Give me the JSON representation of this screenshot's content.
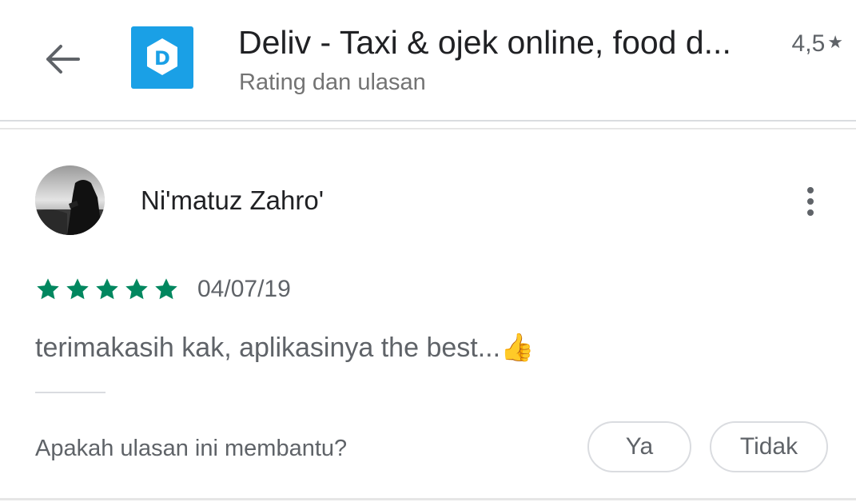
{
  "header": {
    "back_icon": "arrow-back-icon",
    "app_icon": "deliv-app-icon",
    "app_icon_letter": "D",
    "app_title": "Deliv - Taxi & ojek online, food d...",
    "subtitle": "Rating dan ulasan",
    "rating": "4,5",
    "rating_icon": "star-icon"
  },
  "review": {
    "reviewer_name": "Ni'matuz Zahro'",
    "more_icon": "more-vertical-icon",
    "stars": 5,
    "date": "04/07/19",
    "text": "terimakasih kak, aplikasinya the best...",
    "text_emoji": "👍"
  },
  "helpful": {
    "question": "Apakah ulasan ini membantu?",
    "yes_label": "Ya",
    "no_label": "Tidak"
  },
  "colors": {
    "star_green": "#01875f",
    "app_icon_blue": "#1aa0e6",
    "text_gray": "#5f6368"
  }
}
